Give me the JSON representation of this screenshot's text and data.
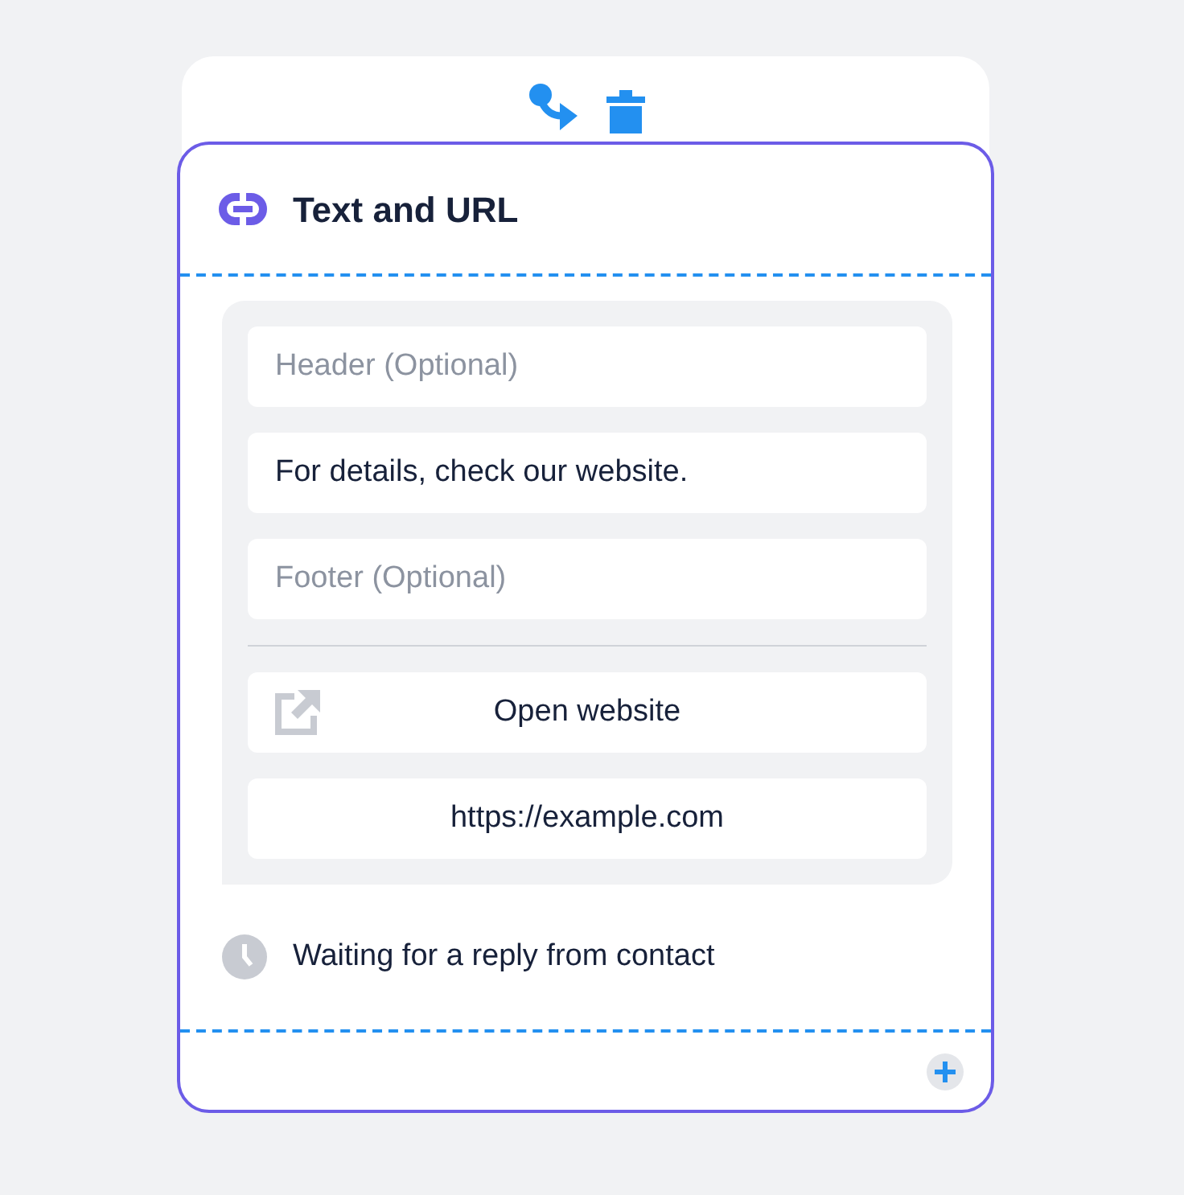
{
  "title": "Text and URL",
  "fields": [
    {
      "placeholder": "Header (Optional)"
    },
    {
      "value": "For details, check our website."
    },
    {
      "placeholder": "Footer (Optional)"
    }
  ],
  "url_button": {
    "label": "Open website",
    "url": "https://example.com"
  },
  "status": "Waiting for a reply from contact"
}
